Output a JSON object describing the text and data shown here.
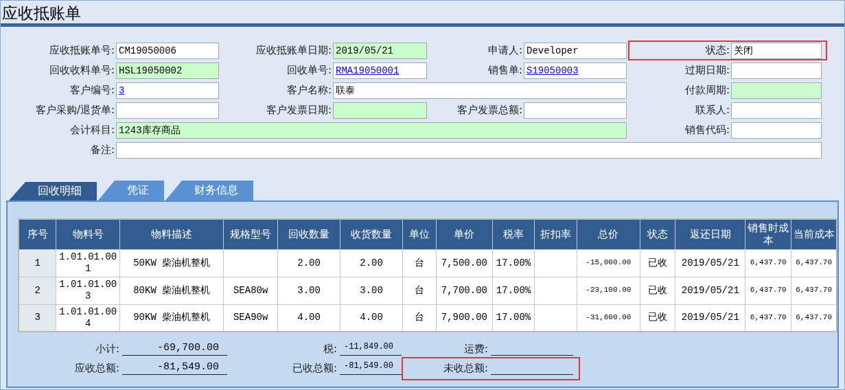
{
  "window": {
    "title": "应收抵账单"
  },
  "form_rows": [
    [
      {
        "label": "应收抵账单号:",
        "value": "CM19050006",
        "kind": "single",
        "link": false,
        "shaded": false,
        "marked": false
      },
      {
        "label": "应收抵账单日期:",
        "value": "2019/05/21",
        "kind": "single",
        "link": false,
        "shaded": true,
        "marked": false
      },
      {
        "label": "申请人:",
        "value": "Developer",
        "kind": "single",
        "link": false,
        "shaded": false,
        "marked": false
      },
      {
        "label": "状态:",
        "value": "关闭",
        "kind": "single",
        "link": false,
        "shaded": false,
        "marked": true
      }
    ],
    [
      {
        "label": "回收收料单号:",
        "value": "HSL19050002",
        "kind": "single",
        "link": false,
        "shaded": true,
        "marked": false
      },
      {
        "label": "回收单号:",
        "value": "RMA19050001",
        "kind": "single",
        "link": true,
        "shaded": false,
        "marked": false
      },
      {
        "label": "销售单:",
        "value": "S19050003",
        "kind": "single",
        "link": true,
        "shaded": false,
        "marked": false
      },
      {
        "label": "过期日期:",
        "kind": "single",
        "shaded": false,
        "marked": false
      }
    ],
    [
      {
        "label": "客户编号:",
        "value": "3",
        "kind": "single",
        "link": true,
        "shaded": false,
        "marked": false
      },
      {
        "label": "客户名称:",
        "value": "联泰",
        "kind": "double",
        "link": false,
        "shaded": false,
        "marked": false
      },
      {
        "label": "付款周期:",
        "kind": "single",
        "shaded": true,
        "marked": false
      }
    ],
    [
      {
        "label": "客户采购/退货单:",
        "kind": "single",
        "shaded": false,
        "marked": false
      },
      {
        "label": "客户发票日期:",
        "kind": "single",
        "shaded": true,
        "marked": false
      },
      {
        "label": "客户发票总额:",
        "kind": "single",
        "shaded": false,
        "marked": false
      },
      {
        "label": "联系人:",
        "kind": "single",
        "shaded": false,
        "marked": false
      }
    ],
    [
      {
        "label": "会计科目:",
        "value": "1243库存商品",
        "kind": "triple",
        "link": false,
        "shaded": true,
        "marked": false
      },
      {
        "label": "销售代码:",
        "kind": "single",
        "shaded": false,
        "marked": false
      }
    ],
    [
      {
        "label": "备注:",
        "kind": "full",
        "shaded": false,
        "marked": false
      }
    ]
  ],
  "tabs": [
    {
      "label": "回收明细",
      "selected": true
    },
    {
      "label": "凭证",
      "selected": false
    },
    {
      "label": "财务信息",
      "selected": false
    }
  ],
  "table": {
    "columns": [
      "序号",
      "物料号",
      "物料描述",
      "规格型号",
      "回收数量",
      "收货数量",
      "单位",
      "单价",
      "税率",
      "折扣率",
      "总价",
      "状态",
      "返还日期",
      "销售时成本",
      "当前成本"
    ],
    "rows": [
      [
        "1",
        "1.01.01.001",
        "50KW 柴油机整机",
        "",
        "2.00",
        "2.00",
        "台",
        "7,500.00",
        "17.00%",
        "",
        "-15,000.00",
        "已收",
        "2019/05/21",
        "6,437.70",
        "6,437.70"
      ],
      [
        "2",
        "1.01.01.003",
        "80KW 柴油机整机",
        "SEA80w",
        "3.00",
        "3.00",
        "台",
        "7,700.00",
        "17.00%",
        "",
        "-23,100.00",
        "已收",
        "2019/05/21",
        "6,437.70",
        "6,437.70"
      ],
      [
        "3",
        "1.01.01.004",
        "90KW 柴油机整机",
        "SEA90w",
        "4.00",
        "4.00",
        "台",
        "7,900.00",
        "17.00%",
        "",
        "-31,600.00",
        "已收",
        "2019/05/21",
        "6,437.70",
        "6,437.70"
      ]
    ]
  },
  "totals": [
    [
      {
        "label": "小计:",
        "value": "-69,700.00",
        "marked": false
      },
      {
        "label": "税:",
        "value": "-11,849.00",
        "marked": false
      },
      {
        "label": "运费:",
        "marked": false
      }
    ],
    [
      {
        "label": "应收总额:",
        "value": "-81,549.00",
        "marked": false
      },
      {
        "label": "已收总额:",
        "value": "-81,549.00",
        "marked": false
      },
      {
        "label": "未收总额:",
        "marked": true
      }
    ]
  ]
}
